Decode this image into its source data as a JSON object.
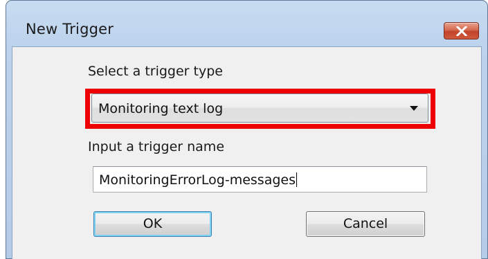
{
  "window": {
    "title": "New Trigger",
    "close_icon": "close-x-icon"
  },
  "trigger_type": {
    "label": "Select a trigger type",
    "selected_value": "Monitoring text log",
    "dropdown_icon": "chevron-down-icon"
  },
  "trigger_name": {
    "label": "Input a trigger name",
    "value": "MonitoringErrorLog-messages"
  },
  "buttons": {
    "ok_label": "OK",
    "cancel_label": "Cancel"
  },
  "colors": {
    "highlight_border": "#ee0000",
    "title_bar": "#b4cce8",
    "close_button": "#c2432a",
    "default_button_border": "#3c7fb1"
  }
}
